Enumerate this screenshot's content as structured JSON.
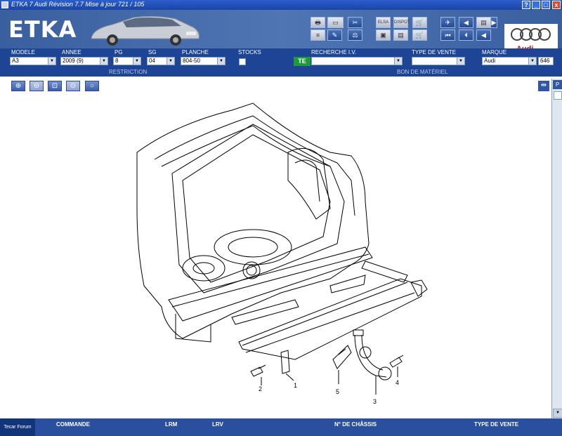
{
  "window": {
    "title": "ETKA 7   Audi Révision 7.7 Mise à jour 721 / 105",
    "help_label": "?",
    "minimize_label": "_",
    "maximize_label": "□",
    "close_label": "x"
  },
  "header": {
    "logo": "ETKA",
    "brand": "Audi",
    "toolbar_icons": [
      "printer-icon",
      "monitor-icon",
      "tools-icon",
      "list-icon",
      "pencil-icon",
      "scale-icon",
      "elsa-icon",
      "dispot-icon",
      "cart-list-icon",
      "monitor-doc-icon",
      "monitor-cart-icon",
      "cart-icon",
      "pin-icon",
      "nav-prev-doc-icon",
      "nav-doc-icon",
      "nav-next-icon",
      "nav-first-icon",
      "nav-back-icon",
      "nav-left-icon"
    ],
    "elsa_label": "ELSA",
    "dispot_label": "DISPOT"
  },
  "filters": {
    "modele_label": "MODELE",
    "modele_value": "A3",
    "annee_label": "ANNEE",
    "annee_value": "2009 (9)",
    "pg_label": "PG",
    "pg_value": "8",
    "sg_label": "SG",
    "sg_value": "04",
    "planche_label": "PLANCHE",
    "planche_value": "804-50",
    "stocks_label": "STOCKS",
    "te_label": "TE",
    "recherche_label": "RECHERCHE I.V.",
    "recherche_value": "",
    "type_vente_label": "TYPE DE VENTE",
    "type_vente_value": "",
    "marque_label": "MARQUE",
    "marque_value": "Audi",
    "extra_value": "646",
    "restriction_label": "RESTRICTION",
    "bon_label": "BON DE MATÉRIEL"
  },
  "zoom_buttons": [
    "zoom-in-icon",
    "zoom-out-icon",
    "zoom-area-icon",
    "zoom-fit-icon",
    "zoom-reset-icon"
  ],
  "right_panel": {
    "tab_label": "P"
  },
  "drawing": {
    "callouts": [
      "1",
      "2",
      "3",
      "4",
      "5"
    ]
  },
  "statusbar": {
    "tecar": "Tecar Forum",
    "commande": "COMMANDE",
    "lrm": "LRM",
    "lrv": "LRV",
    "chassis": "N° DE CHÂSSIS",
    "type_vente": "TYPE DE VENTE"
  }
}
